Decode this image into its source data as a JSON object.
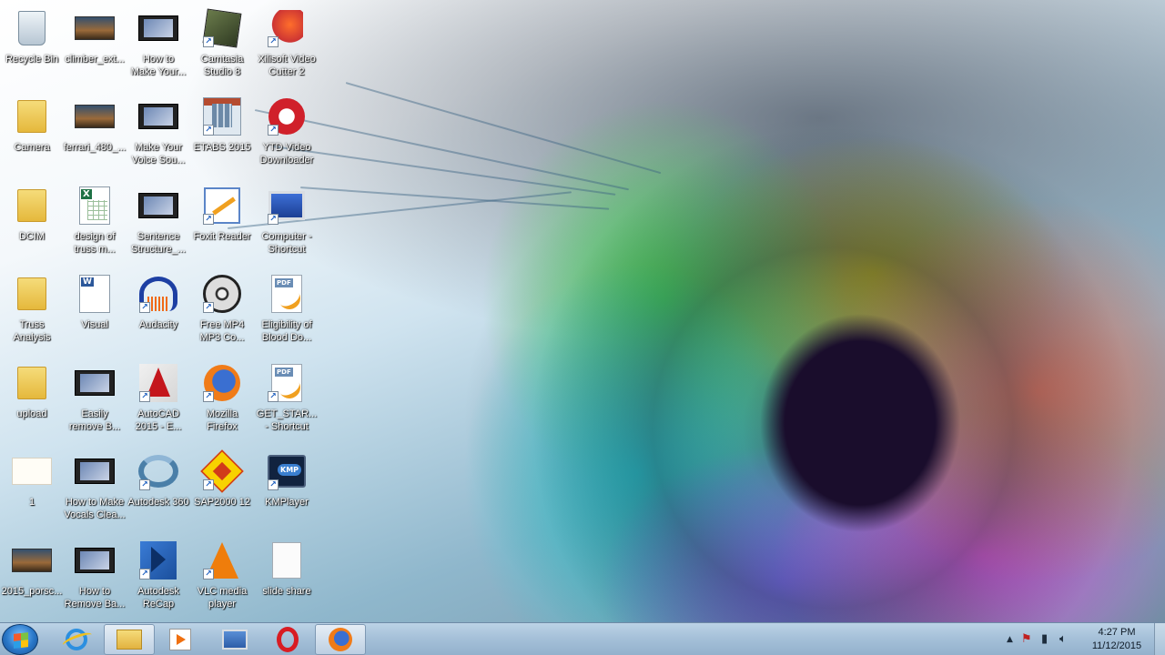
{
  "desktop": {
    "icons": [
      {
        "label": "Recycle Bin",
        "icon": "recycle-bin-icon",
        "shortcut": false
      },
      {
        "label": "climber_ext...",
        "icon": "image-thumbnail-icon",
        "shortcut": false
      },
      {
        "label": "How to\nMake Your...",
        "icon": "video-file-icon",
        "shortcut": false
      },
      {
        "label": "Camtasia\nStudio 8",
        "icon": "camtasia-icon",
        "shortcut": true
      },
      {
        "label": "Xilisoft Video\nCutter 2",
        "icon": "xilisoft-icon",
        "shortcut": true
      },
      {
        "label": "Camera",
        "icon": "folder-icon",
        "shortcut": false
      },
      {
        "label": "ferrari_480_...",
        "icon": "image-thumbnail-icon",
        "shortcut": false
      },
      {
        "label": "Make Your\nVoice Sou...",
        "icon": "video-file-icon",
        "shortcut": false
      },
      {
        "label": "ETABS 2015",
        "icon": "etabs-icon",
        "shortcut": true
      },
      {
        "label": "YTD Video\nDownloader",
        "icon": "ytd-icon",
        "shortcut": true
      },
      {
        "label": "DCIM",
        "icon": "folder-icon",
        "shortcut": false
      },
      {
        "label": "design of\ntruss m...",
        "icon": "excel-file-icon",
        "shortcut": false
      },
      {
        "label": "Sentence\nStructure_...",
        "icon": "video-file-icon",
        "shortcut": false
      },
      {
        "label": "Foxit Reader",
        "icon": "foxit-reader-icon",
        "shortcut": true
      },
      {
        "label": "Computer -\nShortcut",
        "icon": "computer-icon",
        "shortcut": true
      },
      {
        "label": "Truss\nAnalysis",
        "icon": "folder-icon",
        "shortcut": false
      },
      {
        "label": "Visual",
        "icon": "word-file-icon",
        "shortcut": false
      },
      {
        "label": "Audacity",
        "icon": "audacity-icon",
        "shortcut": true
      },
      {
        "label": "Free MP4\nMP3 Co...",
        "icon": "film-reel-icon",
        "shortcut": true
      },
      {
        "label": "Eligibility of\nBlood Do...",
        "icon": "pdf-file-icon",
        "shortcut": false
      },
      {
        "label": "upload",
        "icon": "folder-icon",
        "shortcut": false
      },
      {
        "label": "Easily\nremove B...",
        "icon": "video-file-icon",
        "shortcut": false
      },
      {
        "label": "AutoCAD\n2015 - E...",
        "icon": "autocad-icon",
        "shortcut": true
      },
      {
        "label": "Mozilla\nFirefox",
        "icon": "firefox-icon",
        "shortcut": true
      },
      {
        "label": "GET_STAR...\n- Shortcut",
        "icon": "pdf-file-icon",
        "shortcut": true
      },
      {
        "label": "1",
        "icon": "note-file-icon",
        "shortcut": false
      },
      {
        "label": "How to Make\nVocals Clea...",
        "icon": "video-file-icon",
        "shortcut": false
      },
      {
        "label": "Autodesk 360",
        "icon": "autodesk-360-icon",
        "shortcut": true
      },
      {
        "label": "SAP2000 12",
        "icon": "sap2000-icon",
        "shortcut": true
      },
      {
        "label": "KMPlayer",
        "icon": "kmplayer-icon",
        "shortcut": true
      },
      {
        "label": "2015_porsc...",
        "icon": "image-thumbnail-icon",
        "shortcut": false
      },
      {
        "label": "How to\nRemove Ba...",
        "icon": "video-file-icon",
        "shortcut": false
      },
      {
        "label": "Autodesk\nReCap",
        "icon": "recap-icon",
        "shortcut": true
      },
      {
        "label": "VLC media\nplayer",
        "icon": "vlc-icon",
        "shortcut": true
      },
      {
        "label": "slide share",
        "icon": "blank-file-icon",
        "shortcut": false
      }
    ]
  },
  "taskbar": {
    "start_icon": "windows-start-icon",
    "pinned": [
      {
        "name": "internet-explorer-icon"
      },
      {
        "name": "windows-explorer-icon"
      },
      {
        "name": "windows-media-player-icon"
      },
      {
        "name": "network-app-icon"
      },
      {
        "name": "opera-icon"
      },
      {
        "name": "firefox-icon"
      }
    ],
    "tray": {
      "icons": [
        "show-hidden-icons-icon",
        "action-center-icon",
        "power-icon",
        "volume-icon"
      ],
      "time": "4:27 PM",
      "date": "11/12/2015"
    }
  },
  "colors": {
    "taskbar": "#a6c1d9",
    "label_text": "#ffffff"
  }
}
